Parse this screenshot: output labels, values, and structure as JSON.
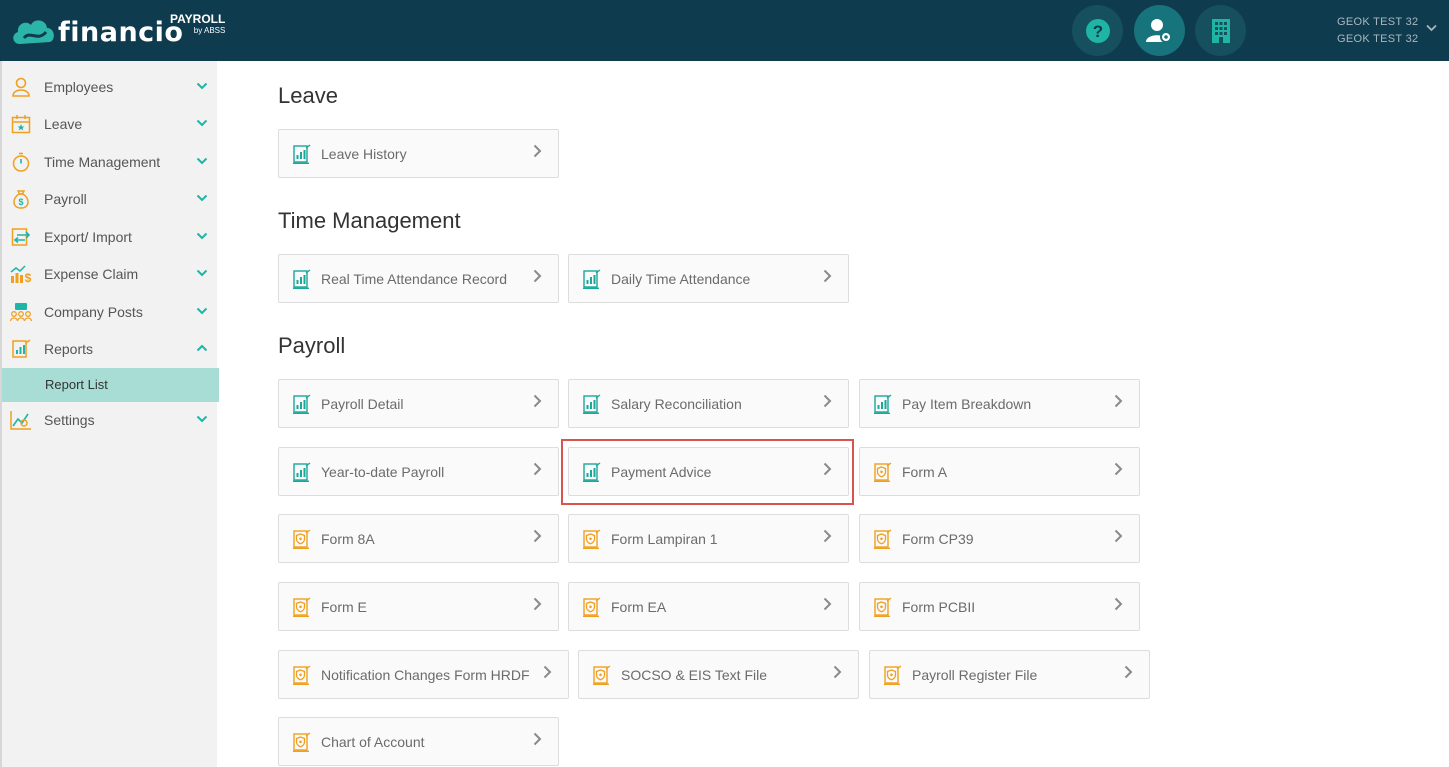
{
  "app": {
    "logo_text": "financio",
    "product": "PAYROLL",
    "by": "by ABSS",
    "user_line1": "GEOK TEST 32",
    "user_line2": "GEOK TEST 32"
  },
  "sidebar": {
    "items": [
      {
        "label": "Employees"
      },
      {
        "label": "Leave"
      },
      {
        "label": "Time Management"
      },
      {
        "label": "Payroll"
      },
      {
        "label": "Export/ Import"
      },
      {
        "label": "Expense Claim"
      },
      {
        "label": "Company Posts"
      },
      {
        "label": "Reports"
      },
      {
        "label": "Settings"
      }
    ],
    "sub_item": "Report List"
  },
  "sections": {
    "leave": "Leave",
    "time": "Time Management",
    "payroll": "Payroll"
  },
  "cards": {
    "leave_history": "Leave History",
    "real_time": "Real Time Attendance Record",
    "daily_time": "Daily Time Attendance",
    "payroll_detail": "Payroll Detail",
    "salary_recon": "Salary Reconciliation",
    "pay_item": "Pay Item Breakdown",
    "ytd_payroll": "Year-to-date Payroll",
    "payment_advice": "Payment Advice",
    "form_a": "Form A",
    "form_8a": "Form 8A",
    "form_lampiran": "Form Lampiran 1",
    "form_cp39": "Form CP39",
    "form_e": "Form E",
    "form_ea": "Form EA",
    "form_pcbii": "Form PCBII",
    "notif_hrdf": "Notification Changes Form HRDF",
    "socso_eis": "SOCSO & EIS Text File",
    "payroll_register": "Payroll Register File",
    "chart_of_account": "Chart of Account"
  },
  "colors": {
    "topbar": "#0f3b4f",
    "accent": "#1fb5a6",
    "highlight": "#d9534f",
    "report_icon": "#1aa89b",
    "form_icon": "#f0a020"
  }
}
